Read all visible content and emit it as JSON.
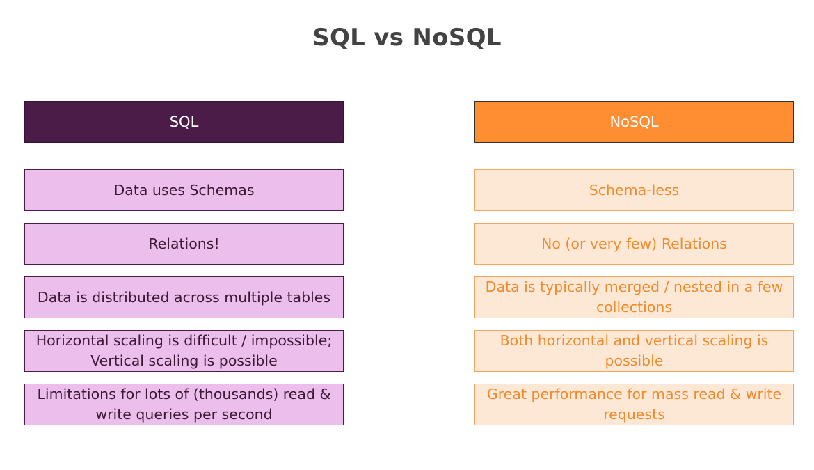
{
  "title": "SQL vs NoSQL",
  "columns": [
    {
      "header": "SQL",
      "items": [
        "Data uses Schemas",
        "Relations!",
        "Data is distributed across multiple tables",
        "Horizontal scaling is difficult / impossible; Vertical scaling is possible",
        "Limitations for lots of (thousands) read & write queries per second"
      ]
    },
    {
      "header": "NoSQL",
      "items": [
        "Schema-less",
        "No (or very few) Relations",
        "Data is typically merged / nested in a few collections",
        "Both horizontal and vertical scaling is possible",
        "Great performance for mass read & write requests"
      ]
    }
  ],
  "colors": {
    "sql_header": "#4c1c48",
    "sql_item": "#ebbeeb",
    "nosql_header": "#ff8e32",
    "nosql_item": "#fde8d6",
    "nosql_text": "#f08a2c",
    "title": "#434343"
  }
}
